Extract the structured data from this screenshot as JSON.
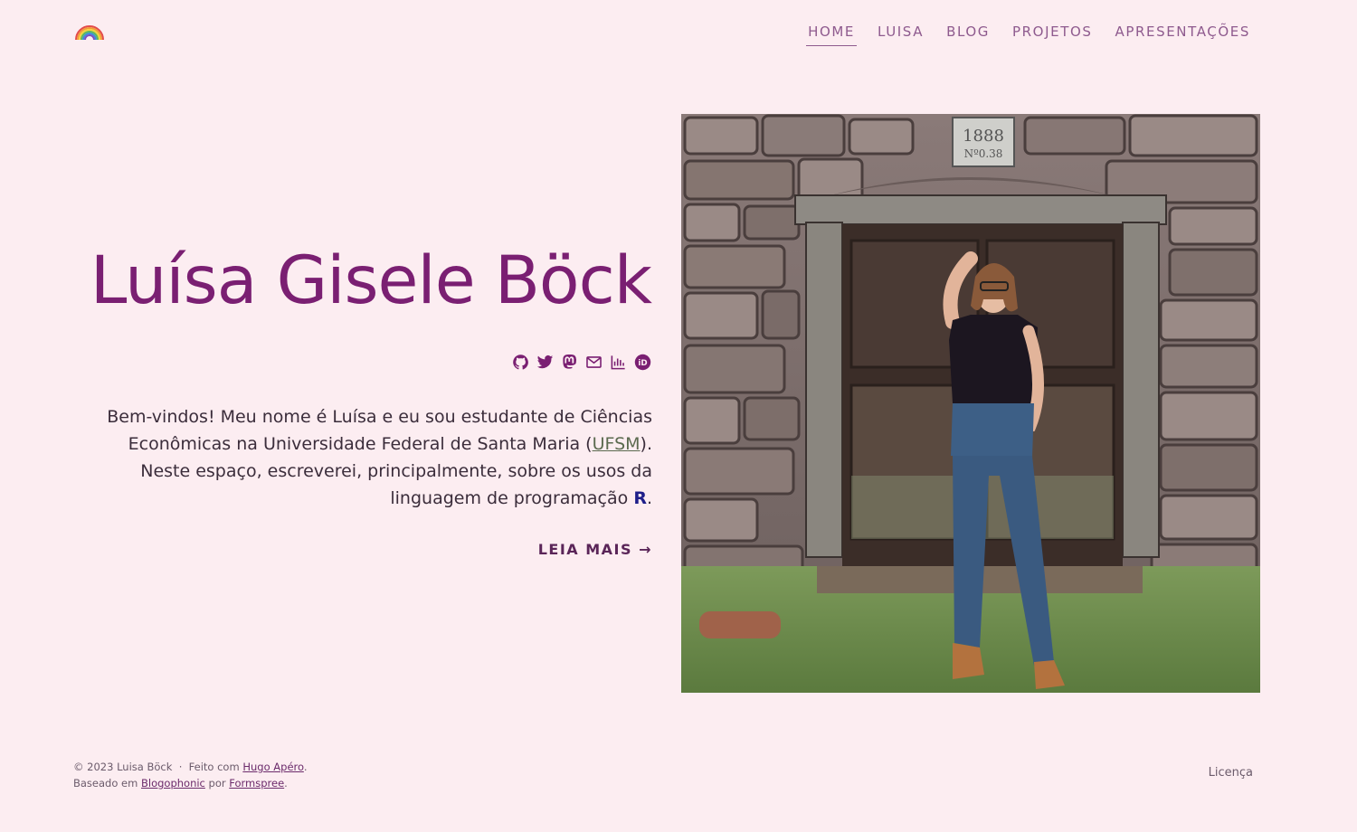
{
  "nav": {
    "items": [
      {
        "label": "HOME",
        "active": true
      },
      {
        "label": "LUISA",
        "active": false
      },
      {
        "label": "BLOG",
        "active": false
      },
      {
        "label": "PROJETOS",
        "active": false
      },
      {
        "label": "APRESENTAÇÕES",
        "active": false
      }
    ]
  },
  "hero": {
    "title": "Luísa Gisele Böck",
    "social_icons": [
      "github-icon",
      "twitter-icon",
      "mastodon-icon",
      "email-icon",
      "stats-icon",
      "orcid-icon"
    ],
    "intro_part1": "Bem-vindos! Meu nome é Luísa e eu sou estudante de Ciências Econômicas na Universidade Federal de Santa Maria (",
    "intro_link": "UFSM",
    "intro_part2": "). Neste espaço, escreverei, principalmente, sobre os usos da linguagem de programação ",
    "intro_r": "R",
    "intro_end": ".",
    "read_more": "LEIA MAIS →"
  },
  "photo": {
    "plaque_year": "1888",
    "plaque_number": "Nº0.38"
  },
  "footer": {
    "copyright": "© 2023 Luisa Böck",
    "separator": "·",
    "made_with": "Feito com",
    "hugo_link": "Hugo Apéro",
    "based_on": "Baseado em",
    "blogophonic_link": "Blogophonic",
    "by": "por",
    "formspree_link": "Formspree",
    "period": ".",
    "license": "Licença"
  },
  "colors": {
    "background": "#fcedf1",
    "title": "#7a1f72",
    "nav": "#8e5a8e",
    "accent": "#5a2558"
  }
}
